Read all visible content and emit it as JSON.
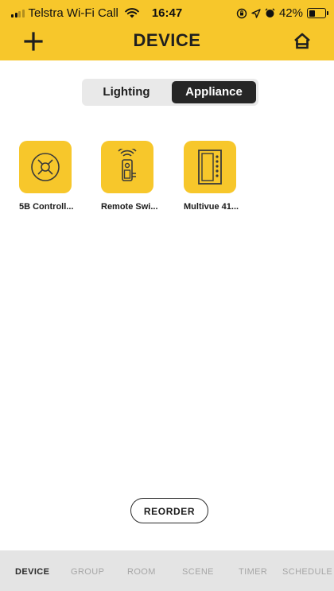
{
  "status_bar": {
    "carrier": "Telstra Wi-Fi Call",
    "time": "16:47",
    "battery_text": "42%",
    "battery_level": 0.42
  },
  "header": {
    "title": "DEVICE",
    "add_icon": "plus-icon",
    "home_icon": "home-icon"
  },
  "tabs_segment": {
    "options": [
      "Lighting",
      "Appliance"
    ],
    "selected": "Appliance"
  },
  "devices": [
    {
      "label": "5B Controll...",
      "icon": "fan-controller-icon"
    },
    {
      "label": "Remote Swi...",
      "icon": "remote-switch-icon"
    },
    {
      "label": "Multivue 41...",
      "icon": "multivue-panel-icon"
    }
  ],
  "reorder_label": "REORDER",
  "bottom_nav": {
    "items": [
      "DEVICE",
      "GROUP",
      "ROOM",
      "SCENE",
      "TIMER",
      "SCHEDULE"
    ],
    "active": "DEVICE"
  },
  "colors": {
    "brand_yellow": "#f7c72b",
    "segment_active": "#262626",
    "tab_bar_bg": "#e4e4e4"
  }
}
